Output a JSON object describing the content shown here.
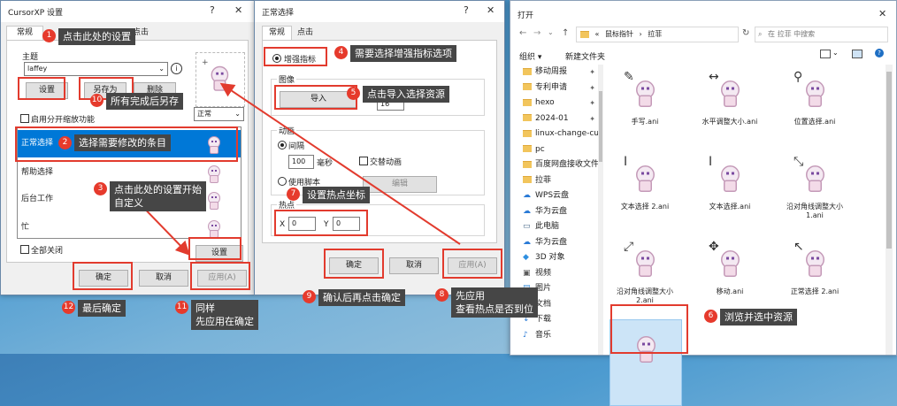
{
  "dialog1": {
    "title": "CursorXP 设置",
    "tabs": [
      "常规",
      "点击"
    ],
    "theme_label": "主题",
    "theme_value": "laffey",
    "btn_settings": "设置",
    "btn_save_as": "另存为",
    "btn_delete": "删除",
    "enable_scaling": "启用分开缩放功能",
    "mode_value": "正常",
    "list": [
      "正常选择",
      "帮助选择",
      "后台工作",
      "忙"
    ],
    "close_all": "全部关闭",
    "btn_settings2": "设置",
    "btn_ok": "确定",
    "btn_cancel": "取消",
    "btn_apply": "应用(A)"
  },
  "dialog2": {
    "title": "正常选择",
    "tabs": [
      "常规",
      "点击"
    ],
    "enhanced_pointer": "增强指标",
    "image_label": "图像",
    "btn_import": "导入",
    "frame_value": "16",
    "anim_label": "动画",
    "interval_label": "间隔",
    "interval_value": "100",
    "ms_label": "毫秒",
    "alt_anim": "交替动画",
    "use_script": "使用脚本",
    "btn_edit": "编辑",
    "hotspot_label": "热点",
    "x_label": "X",
    "x_value": "0",
    "y_label": "Y",
    "y_value": "0",
    "btn_ok": "确定",
    "btn_cancel": "取消",
    "btn_apply": "应用(A)"
  },
  "explorer": {
    "title": "打开",
    "breadcrumb": [
      "«",
      "鼠标指针",
      "›",
      "拉菲"
    ],
    "search_placeholder": "在 拉菲 中搜索",
    "organize": "组织 ▾",
    "new_folder": "新建文件夹",
    "nav": [
      {
        "label": "移动周报",
        "pin": true,
        "icon": "folder"
      },
      {
        "label": "专利申请",
        "pin": true,
        "icon": "folder"
      },
      {
        "label": "hexo",
        "pin": true,
        "icon": "folder"
      },
      {
        "label": "2024-01",
        "pin": true,
        "icon": "folder"
      },
      {
        "label": "linux-change-cu",
        "pin": false,
        "icon": "folder"
      },
      {
        "label": "pc",
        "pin": false,
        "icon": "folder"
      },
      {
        "label": "百度网盘接收文件",
        "pin": false,
        "icon": "folder"
      },
      {
        "label": "拉菲",
        "pin": false,
        "icon": "folder"
      },
      {
        "label": "WPS云盘",
        "pin": false,
        "icon": "cloud"
      },
      {
        "label": "华为云盘",
        "pin": false,
        "icon": "cloud"
      },
      {
        "label": "此电脑",
        "pin": false,
        "icon": "pc"
      },
      {
        "label": "华为云盘",
        "pin": false,
        "icon": "cloud"
      },
      {
        "label": "3D 对象",
        "pin": false,
        "icon": "3d"
      },
      {
        "label": "视频",
        "pin": false,
        "icon": "video"
      },
      {
        "label": "图片",
        "pin": false,
        "icon": "image"
      },
      {
        "label": "文档",
        "pin": false,
        "icon": "doc"
      },
      {
        "label": "下载",
        "pin": false,
        "icon": "download"
      },
      {
        "label": "音乐",
        "pin": false,
        "icon": "music"
      }
    ],
    "files": [
      "手写.ani",
      "水平调整大小.ani",
      "位置选择.ani",
      "文本选择 2.ani",
      "文本选择.ani",
      "沿对角线调整大小 1.ani",
      "沿对角线调整大小 2.ani",
      "移动.ani",
      "正常选择 2.ani",
      ""
    ]
  },
  "callouts": {
    "c1": {
      "num": "1",
      "text": "点击此处的设置"
    },
    "c2": {
      "num": "2",
      "text": "选择需要修改的条目"
    },
    "c3": {
      "num": "3",
      "text1": "点击此处的设置开始",
      "text2": "自定义"
    },
    "c4": {
      "num": "4",
      "text": "需要选择增强指标选项"
    },
    "c5": {
      "num": "5",
      "text": "点击导入选择资源"
    },
    "c6": {
      "num": "6",
      "text": "浏览并选中资源"
    },
    "c7": {
      "num": "7",
      "text": "设置热点坐标"
    },
    "c8": {
      "num": "8",
      "text1": "先应用",
      "text2": "查看热点是否到位"
    },
    "c9": {
      "num": "9",
      "text": "确认后再点击确定"
    },
    "c10": {
      "num": "10",
      "text": "所有完成后另存"
    },
    "c11": {
      "num": "11",
      "text1": "同样",
      "text2": "先应用在确定"
    },
    "c12": {
      "num": "12",
      "text": "最后确定"
    }
  },
  "colors": {
    "accent_red": "#e23b2e",
    "selection_blue": "#0078d7",
    "callout_bg": "#464646"
  }
}
